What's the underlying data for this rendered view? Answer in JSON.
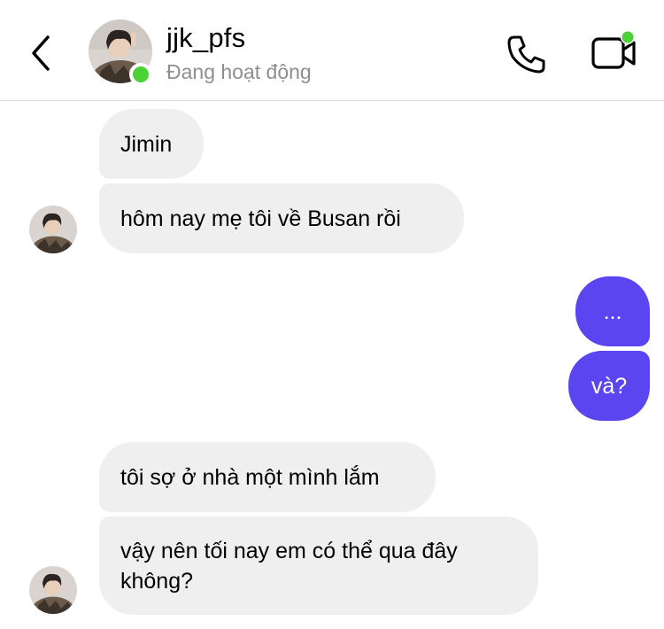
{
  "header": {
    "username": "jjk_pfs",
    "status": "Đang hoạt động"
  },
  "messages": [
    {
      "sender": "them",
      "text": "Jimin"
    },
    {
      "sender": "them",
      "text": "hôm nay mẹ tôi về Busan rồi"
    },
    {
      "sender": "me",
      "text": "..."
    },
    {
      "sender": "me",
      "text": "và?"
    },
    {
      "sender": "them",
      "text": "tôi sợ ở nhà một mình lắm"
    },
    {
      "sender": "them",
      "text": "vậy nên tối nay em có thể qua đây không?"
    }
  ],
  "colors": {
    "outgoing_bubble": "#5b45f0",
    "incoming_bubble": "#efefef",
    "online_dot": "#4cd137",
    "status_text": "#8e8e8e"
  },
  "icons": {
    "back": "chevron-left-icon",
    "call": "phone-icon",
    "video": "video-camera-icon"
  }
}
